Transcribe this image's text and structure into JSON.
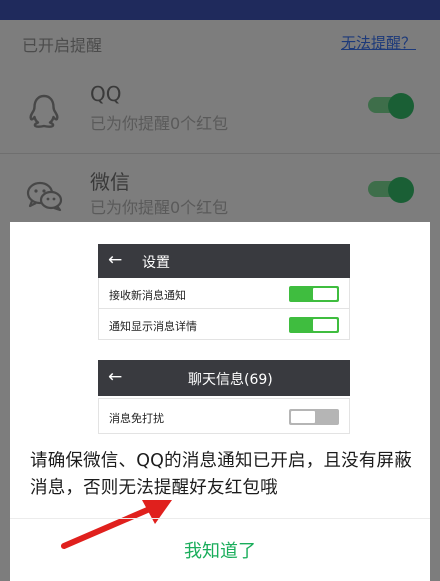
{
  "background": {
    "section_title": "已开启提醒",
    "help_link": "无法提醒？",
    "apps": [
      {
        "name": "QQ",
        "status": "已为你提醒0个红包",
        "icon": "qq-penguin-icon",
        "enabled": true
      },
      {
        "name": "微信",
        "status": "已为你提醒0个红包",
        "icon": "wechat-icon",
        "enabled": true
      }
    ]
  },
  "dialog": {
    "settings_screenshot": {
      "title": "设置",
      "rows": [
        {
          "label": "接收新消息通知",
          "on": true
        },
        {
          "label": "通知显示消息详情",
          "on": true
        }
      ]
    },
    "chat_screenshot": {
      "title": "聊天信息(69)",
      "rows": [
        {
          "label": "消息免打扰",
          "on": false
        }
      ]
    },
    "message": "请确保微信、QQ的消息通知已开启，且没有屏蔽消息，否则无法提醒好友红包哦",
    "confirm": "我知道了"
  },
  "colors": {
    "accent_green": "#1aad5b",
    "switch_on": "#3fbd3f",
    "header_dark": "#393a3f"
  }
}
